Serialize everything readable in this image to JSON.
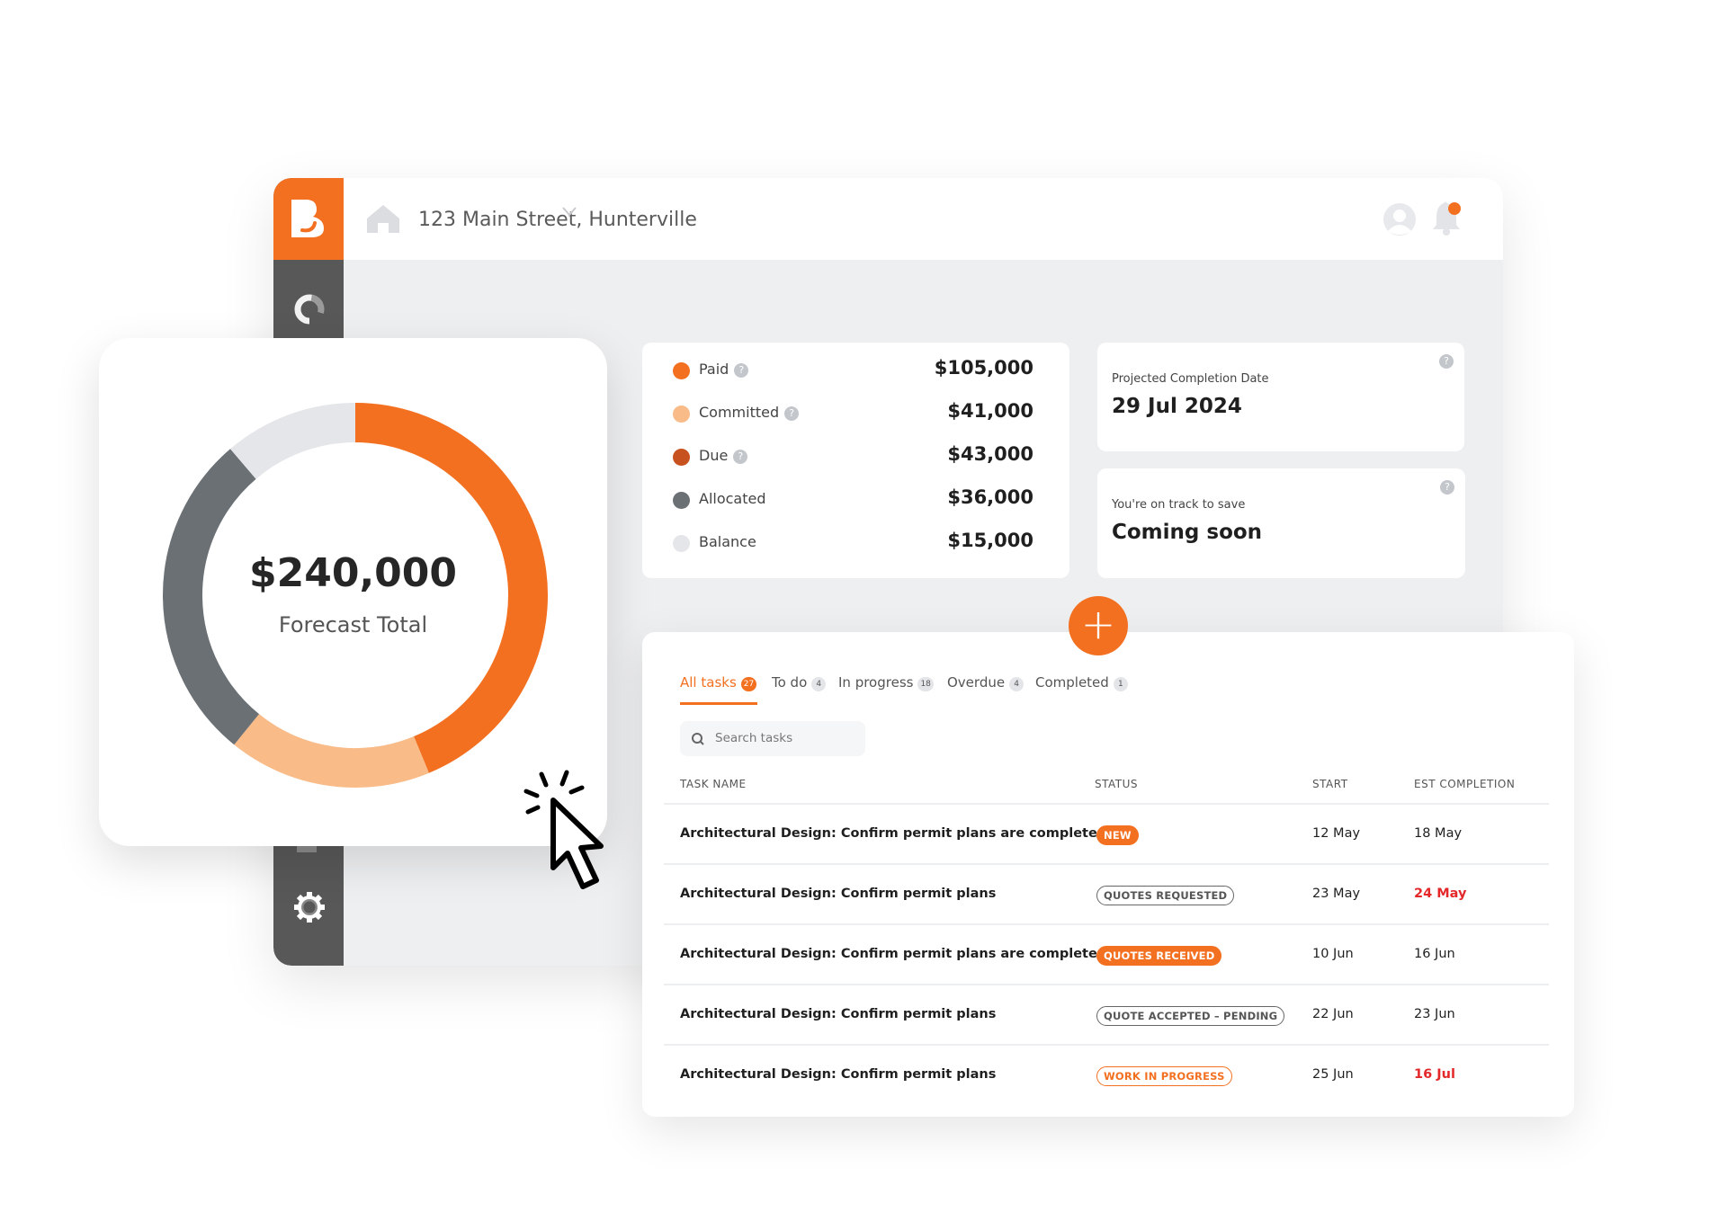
{
  "header": {
    "address": "123 Main Street, Hunterville",
    "icons": [
      "home-icon",
      "chevron-down-icon",
      "user-avatar-icon",
      "bell-icon"
    ]
  },
  "sidebar": {
    "icons": [
      "logo",
      "budget-donut-icon",
      "settings-gear-icon"
    ]
  },
  "colors": {
    "accent": "#f37021",
    "committed": "#f9bb87",
    "due": "#c8521f",
    "allocated": "#6b7075",
    "balance": "#e4e6e9",
    "overdue": "#e4282a",
    "sidebar": "#585858"
  },
  "forecast": {
    "total": "$240,000",
    "label": "Forecast Total"
  },
  "chart_data": {
    "type": "pie",
    "variant": "donut",
    "segments": [
      {
        "key": "paid",
        "value": 105000,
        "color": "#f37021"
      },
      {
        "key": "committed",
        "value": 41000,
        "color": "#f9bb87"
      },
      {
        "key": "allocated",
        "value": 67000,
        "color": "#6b7075"
      },
      {
        "key": "balance",
        "value": 27000,
        "color": "#e4e6e9"
      }
    ]
  },
  "legend": [
    {
      "label": "Paid",
      "value": "$105,000",
      "help": "?",
      "color": "#f37021"
    },
    {
      "label": "Committed",
      "value": "$41,000",
      "help": "?",
      "color": "#f9bb87"
    },
    {
      "label": "Due",
      "value": "$43,000",
      "help": "?",
      "color": "#c8521f"
    },
    {
      "label": "Allocated",
      "value": "$36,000",
      "color": "#6b7075"
    },
    {
      "label": "Balance",
      "value": "$15,000",
      "color": "#e4e6e9"
    }
  ],
  "projected": {
    "label": "Projected Completion Date",
    "value": "29 Jul 2024",
    "help": "?"
  },
  "savings": {
    "label": "You're on track to save",
    "value": "Coming soon",
    "help": "?"
  },
  "add_button": "+",
  "tabs": [
    {
      "label": "All tasks",
      "count": "27",
      "active": true
    },
    {
      "label": "To do",
      "count": "4"
    },
    {
      "label": "In progress",
      "count": "18"
    },
    {
      "label": "Overdue",
      "count": "4"
    },
    {
      "label": "Completed",
      "count": "1"
    }
  ],
  "search": {
    "placeholder": "Search tasks"
  },
  "table": {
    "headers": [
      "TASK NAME",
      "STATUS",
      "START",
      "EST COMPLETION"
    ],
    "rows": [
      {
        "task": "Architectural Design: Confirm permit plans are complete",
        "status": "NEW",
        "status_style": "filled",
        "start": "12 May",
        "end": "18 May",
        "overdue": false
      },
      {
        "task": "Architectural Design: Confirm permit plans",
        "status": "QUOTES REQUESTED",
        "status_style": "outline-gray",
        "start": "23 May",
        "end": "24 May",
        "overdue": true
      },
      {
        "task": "Architectural Design: Confirm permit plans are complete",
        "status": "QUOTES RECEIVED",
        "status_style": "filled",
        "start": "10 Jun",
        "end": "16 Jun",
        "overdue": false
      },
      {
        "task": "Architectural Design: Confirm permit plans",
        "status": "QUOTE ACCEPTED – PENDING",
        "status_style": "outline-gray",
        "start": "22 Jun",
        "end": "23 Jun",
        "overdue": false
      },
      {
        "task": "Architectural Design: Confirm permit plans",
        "status": "WORK IN PROGRESS",
        "status_style": "outline-orange",
        "start": "25 Jun",
        "end": "16 Jul",
        "overdue": true
      }
    ]
  }
}
